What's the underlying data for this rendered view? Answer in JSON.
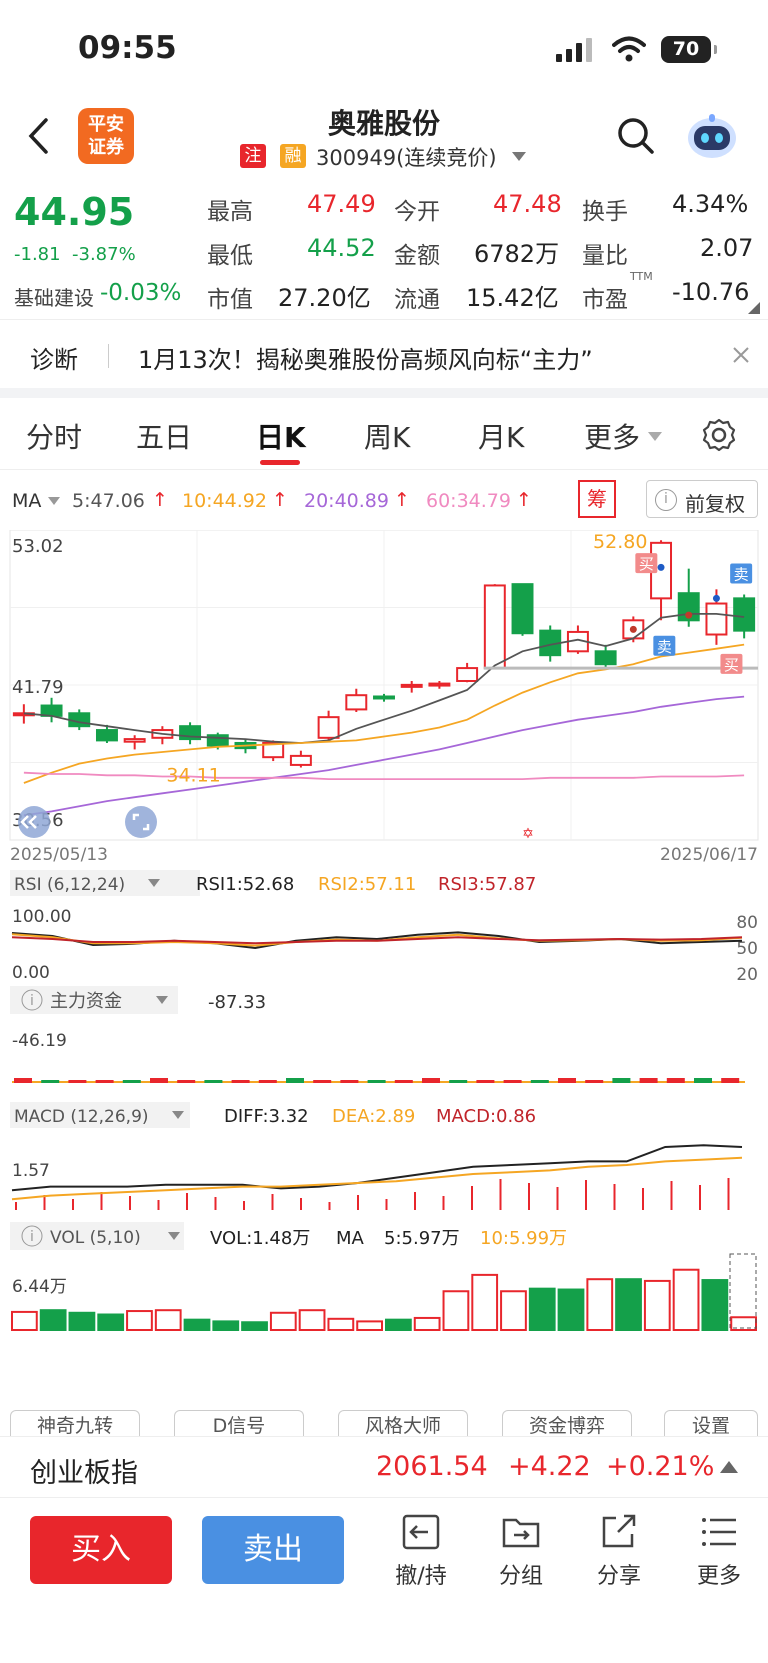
{
  "status": {
    "time": "09:55",
    "battery": "70"
  },
  "header": {
    "title": "奥雅股份",
    "badge_zhu": "注",
    "badge_rong": "融",
    "code": "300949(连续竞价)",
    "logo_line1": "平安",
    "logo_line2": "证券"
  },
  "quote": {
    "price": "44.95",
    "change": "-1.81",
    "change_pct": "-3.87%",
    "sector": "基础建设",
    "sector_pct": "-0.03%",
    "high_label": "最高",
    "high": "47.49",
    "open_label": "今开",
    "open": "47.48",
    "turnover_label": "换手",
    "turnover": "4.34%",
    "low_label": "最低",
    "low": "44.52",
    "amount_label": "金额",
    "amount": "6782万",
    "vol_ratio_label": "量比",
    "vol_ratio": "2.07",
    "mcap_label": "市值",
    "mcap": "27.20亿",
    "float_label": "流通",
    "float": "15.42亿",
    "pe_label": "市盈",
    "pe_sup": "TTM",
    "pe": "-10.76"
  },
  "diagnosis": {
    "label": "诊断",
    "text": "1月13次！揭秘奥雅股份高频风向标“主力”"
  },
  "tabs": [
    "分时",
    "五日",
    "日K",
    "周K",
    "月K",
    "更多"
  ],
  "ma_bar": {
    "label": "MA",
    "ma5": "5:47.06",
    "ma10": "10:44.92",
    "ma20": "20:40.89",
    "ma60": "60:34.79",
    "chou": "筹",
    "fuquan": "前复权"
  },
  "colors": {
    "up": "#e8262c",
    "down": "#14a04a",
    "ma5": "#555555",
    "ma10": "#f5a623",
    "ma20": "#a667d8",
    "ma60": "#f08ac0",
    "accent": "#e8262c",
    "sell_blue": "#4a90e2"
  },
  "chart_data": [
    {
      "type": "candlestick",
      "title": "日K",
      "x_start": "2025/05/13",
      "x_end": "2025/06/17",
      "y_labels": [
        "53.02",
        "41.79",
        "30.56"
      ],
      "ylim": [
        30.56,
        53.02
      ],
      "annotations": {
        "high": "52.80",
        "low": "34.11",
        "buy": "买",
        "sell": "卖"
      },
      "candles": [
        [
          39.5,
          39.6,
          38.8,
          40.3
        ],
        [
          40.2,
          39.4,
          38.9,
          40.8
        ],
        [
          39.6,
          38.6,
          38.3,
          39.9
        ],
        [
          38.3,
          37.5,
          37.3,
          38.7
        ],
        [
          37.4,
          37.6,
          36.8,
          37.9
        ],
        [
          37.7,
          38.3,
          37.2,
          38.6
        ],
        [
          38.6,
          37.6,
          37.2,
          38.9
        ],
        [
          37.9,
          37.1,
          36.8,
          38.1
        ],
        [
          37.3,
          36.9,
          36.5,
          37.6
        ],
        [
          36.2,
          37.3,
          35.9,
          37.5
        ],
        [
          35.6,
          36.3,
          35.4,
          36.7
        ],
        [
          37.7,
          39.3,
          37.5,
          39.8
        ],
        [
          39.9,
          41.0,
          39.7,
          41.5
        ],
        [
          40.9,
          40.8,
          40.5,
          41.1
        ],
        [
          41.7,
          41.8,
          41.2,
          42.1
        ],
        [
          41.8,
          41.9,
          41.5,
          42.1
        ],
        [
          42.1,
          43.1,
          42.0,
          43.5
        ],
        [
          43.1,
          49.5,
          43.1,
          49.6
        ],
        [
          49.6,
          45.8,
          45.6,
          49.6
        ],
        [
          46.0,
          44.1,
          43.6,
          46.4
        ],
        [
          44.4,
          45.9,
          44.2,
          46.4
        ],
        [
          44.4,
          43.4,
          43.1,
          44.9
        ],
        [
          45.4,
          46.8,
          45.1,
          47.1
        ],
        [
          48.5,
          52.8,
          46.8,
          53.0
        ],
        [
          48.9,
          46.8,
          46.3,
          50.8
        ],
        [
          45.7,
          48.1,
          44.9,
          49.2
        ],
        [
          48.5,
          46.0,
          45.4,
          48.8
        ]
      ],
      "ma": {
        "MA5": [
          39.6,
          39.4,
          38.9,
          38.6,
          38.3,
          38.0,
          37.8,
          37.7,
          37.6,
          37.4,
          37.3,
          37.5,
          38.4,
          39.1,
          39.8,
          40.6,
          41.4,
          43.3,
          44.4,
          44.9,
          45.3,
          44.8,
          45.4,
          47.0,
          47.3,
          47.3,
          47.06
        ],
        "MA10": [
          34.2,
          35.0,
          35.7,
          36.1,
          36.4,
          36.6,
          36.8,
          37.0,
          37.1,
          37.2,
          37.3,
          37.4,
          37.5,
          37.8,
          38.1,
          38.5,
          39.1,
          40.2,
          41.2,
          42.0,
          42.7,
          43.0,
          43.4,
          44.0,
          44.3,
          44.6,
          44.92
        ],
        "MA20": [
          31.7,
          32.0,
          32.4,
          32.8,
          33.1,
          33.4,
          33.7,
          34.0,
          34.3,
          34.6,
          34.9,
          35.2,
          35.6,
          36.0,
          36.4,
          36.8,
          37.3,
          37.8,
          38.3,
          38.7,
          39.1,
          39.4,
          39.7,
          40.1,
          40.4,
          40.7,
          40.89
        ],
        "MA60": [
          35.0,
          34.9,
          34.9,
          34.8,
          34.8,
          34.7,
          34.7,
          34.6,
          34.6,
          34.6,
          34.6,
          34.5,
          34.5,
          34.5,
          34.5,
          34.5,
          34.5,
          34.5,
          34.5,
          34.6,
          34.6,
          34.6,
          34.6,
          34.7,
          34.7,
          34.7,
          34.79
        ]
      }
    },
    {
      "type": "line",
      "title": "RSI",
      "label": "RSI (6,12,24)",
      "legend": [
        "RSI1:52.68",
        "RSI2:57.11",
        "RSI3:57.87"
      ],
      "y_labels": [
        "100.00",
        "0.00"
      ],
      "right_labels": [
        "80",
        "50",
        "20"
      ],
      "ylim": [
        0,
        100
      ],
      "series": {
        "RSI1": [
          65,
          60,
          45,
          47,
          52,
          48,
          40,
          52,
          58,
          55,
          62,
          66,
          60,
          50,
          52,
          55,
          48,
          50,
          52
        ],
        "RSI2": [
          63,
          58,
          48,
          48,
          50,
          48,
          44,
          50,
          54,
          52,
          58,
          62,
          56,
          52,
          53,
          55,
          52,
          53,
          57
        ],
        "RSI3": [
          58,
          55,
          50,
          50,
          52,
          50,
          48,
          50,
          52,
          52,
          55,
          58,
          55,
          53,
          54,
          55,
          54,
          55,
          58
        ]
      }
    },
    {
      "type": "bar",
      "title": "主力资金",
      "label": "主力资金",
      "value": "-87.33",
      "y_label": "-46.19"
    },
    {
      "type": "line",
      "title": "MACD",
      "label": "MACD (12,26,9)",
      "legend": [
        "DIFF:3.32",
        "DEA:2.89",
        "MACD:0.86"
      ],
      "y_label": "1.57",
      "series": {
        "DIFF": [
          1.1,
          1.3,
          1.3,
          1.3,
          1.4,
          1.4,
          1.4,
          1.2,
          1.3,
          1.5,
          1.8,
          2.1,
          2.4,
          2.5,
          2.6,
          2.7,
          2.7,
          3.5,
          3.6,
          3.5
        ],
        "DEA": [
          0.6,
          0.8,
          0.9,
          1.0,
          1.1,
          1.2,
          1.3,
          1.3,
          1.4,
          1.5,
          1.6,
          1.8,
          2.0,
          2.1,
          2.2,
          2.4,
          2.5,
          2.7,
          2.8,
          2.9
        ]
      }
    },
    {
      "type": "bar",
      "title": "VOL",
      "label": "VOL (5,10)",
      "legend": [
        "VOL:1.48万",
        "MA",
        "5:5.97万",
        "10:5.99万"
      ],
      "y_label": "6.44万",
      "values": [
        2.1,
        2.3,
        2.0,
        1.8,
        2.2,
        2.3,
        1.2,
        1.0,
        0.9,
        2.0,
        2.3,
        1.3,
        1.0,
        1.2,
        1.4,
        4.5,
        6.4,
        4.5,
        4.8,
        4.7,
        5.9,
        5.9,
        5.7,
        7.0,
        5.8,
        1.48
      ]
    }
  ],
  "indicator_buttons": [
    "神奇九转",
    "D信号",
    "风格大师",
    "资金博弈",
    "设置"
  ],
  "index_bar": {
    "name": "创业板指",
    "value": "2061.54",
    "change": "+4.22",
    "pct": "+0.21%"
  },
  "bottom": {
    "buy": "买入",
    "sell": "卖出",
    "tools": [
      "撤/持",
      "分组",
      "分享",
      "更多"
    ]
  }
}
